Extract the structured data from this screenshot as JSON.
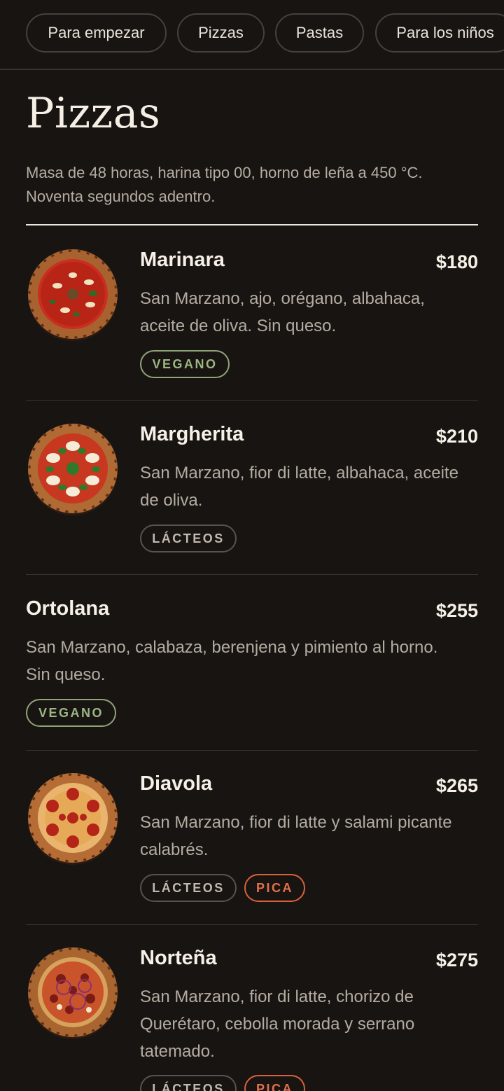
{
  "tabs": [
    "Para empezar",
    "Pizzas",
    "Pastas",
    "Para los niños"
  ],
  "section": {
    "title": "Pizzas",
    "subtitle_line1": "Masa de 48 horas, harina tipo 00, horno de leña a 450 °C.",
    "subtitle_line2": "Noventa segundos adentro."
  },
  "items": [
    {
      "name": "Marinara",
      "price": "$180",
      "desc_lines": [
        "San Marzano, ajo, orégano, albahaca,",
        "aceite de oliva. Sin queso."
      ],
      "tags": [
        "VEGANO"
      ],
      "image": "pizza-marinara"
    },
    {
      "name": "Margherita",
      "price": "$210",
      "desc_lines": [
        "San Marzano, fior di latte, albahaca, aceite",
        "de oliva."
      ],
      "tags": [
        "LÁCTEOS"
      ],
      "image": "pizza-margherita"
    },
    {
      "name": "Ortolana",
      "price": "$255",
      "desc_lines": [
        "San Marzano, calabaza, berenjena y pimiento al horno.",
        "Sin queso."
      ],
      "tags": [
        "VEGANO"
      ],
      "image": null
    },
    {
      "name": "Diavola",
      "price": "$265",
      "desc_lines": [
        "San Marzano, fior di latte y salami picante",
        "calabrés."
      ],
      "tags": [
        "LÁCTEOS",
        "PICA"
      ],
      "image": "pizza-diavola"
    },
    {
      "name": "Norteña",
      "price": "$275",
      "desc_lines": [
        "San Marzano, fior di latte, chorizo de",
        "Querétaro, cebolla morada y serrano",
        "tatemado."
      ],
      "tags": [
        "LÁCTEOS",
        "PICA"
      ],
      "image": "pizza-nortena"
    }
  ],
  "colors": {
    "background": "#181412",
    "vegan": "#9cb684",
    "spicy": "#e3714b",
    "dairy": "#c2b9ae"
  }
}
